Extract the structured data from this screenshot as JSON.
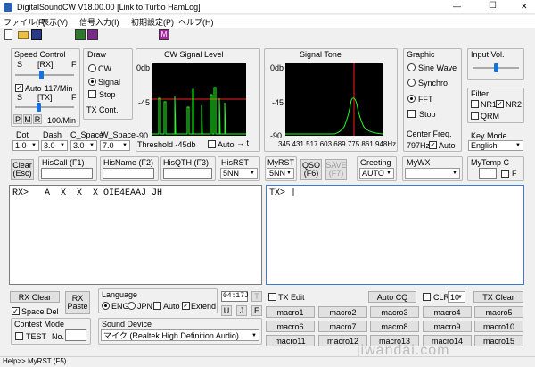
{
  "window": {
    "title": "DigitalSoundCW V18.00.00  [Link to Turbo HamLog]",
    "minimize": "—",
    "maximize": "☐",
    "close": "✕"
  },
  "menu": [
    "ファイル(F)",
    "表示(V)",
    "信号入力(I)",
    "初期設定(P)",
    "ヘルプ(H)"
  ],
  "toolbar": {
    "icons": [
      "new-file-icon",
      "open-folder-icon",
      "save-icon",
      "rx-monitor-icon",
      "tx-monitor-icon",
      "morse-key-icon"
    ],
    "m_label": "M"
  },
  "speed_control": {
    "title": "Speed Control",
    "rx_s": "S",
    "rx_label": "[RX]",
    "rx_f": "F",
    "auto_label": "Auto",
    "auto_checked": true,
    "rx_speed": "117/Min",
    "tx_s": "S",
    "tx_label": "[TX]",
    "tx_f": "F",
    "tx_speed": "100/Min",
    "p": "P",
    "m": "M",
    "r": "R",
    "rx_level": 0.45,
    "tx_level": 0.4
  },
  "draw": {
    "title": "Draw",
    "options": [
      "CW",
      "Signal"
    ],
    "selected": "Signal",
    "stop_label": "Stop",
    "tx_cont": "TX Cont."
  },
  "cw_signal": {
    "title": "CW Signal Level",
    "y_top": "0db",
    "y_mid": "-45",
    "y_bot": "-90",
    "threshold": "Threshold -45db",
    "auto_label": "Auto",
    "arrow": "→ t"
  },
  "signal_tone": {
    "title": "Signal Tone",
    "y_top": "0db",
    "y_mid": "-45",
    "y_bot": "-90",
    "x_ticks": "345 431 517 603 689 775 861 948Hz"
  },
  "graphic": {
    "title": "Graphic",
    "options": [
      "Sine Wave",
      "Synchro",
      "FFT"
    ],
    "selected": "FFT",
    "stop_label": "Stop",
    "center_freq_label": "Center Freq.",
    "center_freq": "797Hz",
    "auto_label": "Auto",
    "auto_checked": true
  },
  "input_vol": {
    "title": "Input Vol.",
    "level": 0.5
  },
  "filter": {
    "title": "Filter",
    "nr1": "NR1",
    "nr2": "NR2",
    "qrm": "QRM",
    "nr1_checked": false,
    "nr2_checked": true,
    "qrm_checked": false
  },
  "key_mode": {
    "title": "Key Mode",
    "value": "English"
  },
  "timing": {
    "dot_label": "Dot",
    "dot": "1.0",
    "dash_label": "Dash",
    "dash": "3.0",
    "cspace_label": "C_Space",
    "cspace": "3.0",
    "wspace_label": "W_Space",
    "wspace": "7.0"
  },
  "fields": {
    "clear": "Clear\n(Esc)",
    "his_call": "HisCall (F1)",
    "his_name": "HisName (F2)",
    "his_qth": "HisQTH (F3)",
    "his_rst_label": "HisRST",
    "his_rst": "5NN",
    "my_rst_label": "MyRST",
    "my_rst": "5NN",
    "qso": "QSO\n(F6)",
    "save": "SAVE\n(F7)",
    "greeting_label": "Greeting",
    "greeting": "AUTO",
    "my_wx": "MyWX",
    "my_temp": "MyTemp C",
    "f_label": "F"
  },
  "rx_text": "RX>   A  X  X  X OIE4EAAJ JH",
  "tx_text": "TX> |",
  "bottom": {
    "rx_clear": "RX Clear",
    "rx_paste": "RX\nPaste",
    "space_del": "Space Del",
    "space_del_checked": true,
    "language_label": "Language",
    "eng": "ENG",
    "jpn": "JPN",
    "lang_selected": "ENG",
    "auto_label": "Auto",
    "extend_label": "Extend",
    "extend_checked": true,
    "time": "04:17J",
    "t_btn": "T",
    "u_btn": "U",
    "j_btn": "J",
    "e_btn": "E",
    "tx_edit": "TX Edit",
    "auto_cq": "Auto CQ",
    "clr": "CLR",
    "clr_count": "10",
    "tx_clear": "TX Clear",
    "contest_label": "Contest Mode",
    "test_label": "TEST",
    "no_label": "No.",
    "sound_device_label": "Sound Device",
    "sound_device": "マイク (Realtek High Definition Audio)"
  },
  "macros": [
    "macro1",
    "macro2",
    "macro3",
    "macro4",
    "macro5",
    "macro6",
    "macro7",
    "macro8",
    "macro9",
    "macro10",
    "macro11",
    "macro12",
    "macro13",
    "macro14",
    "macro15"
  ],
  "status": "Help>> MyRST (F5)",
  "watermark": "jiwandai.com"
}
